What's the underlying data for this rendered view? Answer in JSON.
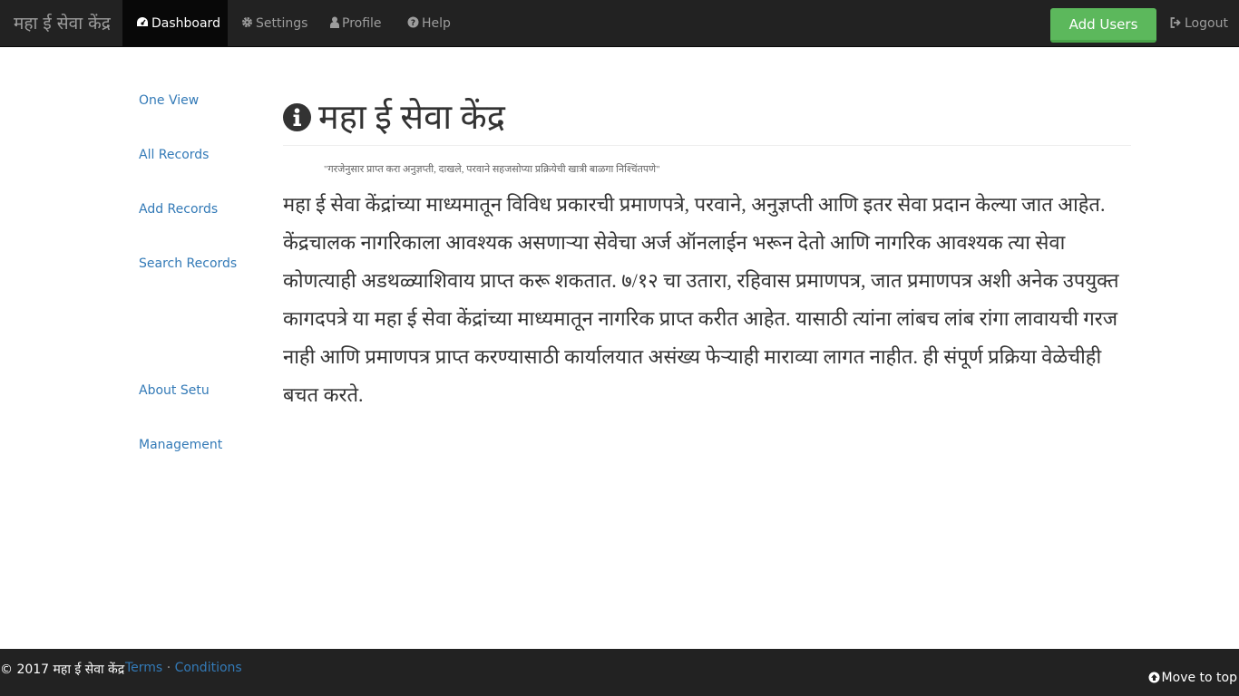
{
  "navbar": {
    "brand": "महा ई सेवा केंद्र",
    "items": [
      {
        "label": "Dashboard",
        "icon": "dashboard-icon",
        "active": true
      },
      {
        "label": "Settings",
        "icon": "gear-icon",
        "active": false
      },
      {
        "label": "Profile",
        "icon": "user-icon",
        "active": false
      },
      {
        "label": "Help",
        "icon": "question-circle-icon",
        "active": false
      }
    ],
    "add_users_label": "Add Users",
    "logout_label": "Logout"
  },
  "sidebar": {
    "items": [
      {
        "label": "One View"
      },
      {
        "label": "All Records"
      },
      {
        "label": "Add Records"
      },
      {
        "label": "Search Records"
      },
      {
        "label": "About Setu"
      },
      {
        "label": "Management"
      }
    ]
  },
  "main": {
    "title": "महा ई सेवा केंद्र",
    "tagline": "\"गरजेनुसार प्राप्त करा अनुज्ञप्ती, दाखले, परवाने सहजसोप्या प्रक्रियेची खात्री बाळगा निश्चिंतपणे\"",
    "body": "महा ई सेवा केंद्रांच्या माध्यमातून विविध प्रकारची प्रमाणपत्रे, परवाने, अनुज्ञप्ती आणि इतर सेवा प्रदान केल्या जात आहेत. केंद्रचालक नागरिकाला आवश्यक असणाऱ्या सेवेचा अर्ज ऑनलाईन भरून देतो आणि नागरिक आवश्यक त्या सेवा कोणत्याही अडथळ्याशिवाय प्राप्त करू शकतात. ७/१२ चा उतारा, रहिवास प्रमाणपत्र, जात प्रमाणपत्र अशी अनेक उपयुक्त कागदपत्रे या महा ई सेवा केंद्रांच्या माध्यमातून नागरिक प्राप्त करीत आहेत. यासाठी त्यांना लांबच लांब रांगा लावायची गरज नाही आणि प्रमाणपत्र प्राप्त करण्यासाठी कार्यालयात असंख्य फेऱ्याही माराव्या लागत नाहीत. ही संपूर्ण प्रक्रिया वेळेचीही बचत करते."
  },
  "footer": {
    "copyright": "© 2017 महा ई सेवा केंद्र",
    "terms_label": "Terms",
    "separator": "·",
    "conditions_label": "Conditions",
    "move_to_top_label": "Move to top"
  },
  "colors": {
    "navbar_bg": "#222222",
    "active_nav_bg": "#080808",
    "add_users_bg": "#5cb85c",
    "link": "#337ab7"
  }
}
